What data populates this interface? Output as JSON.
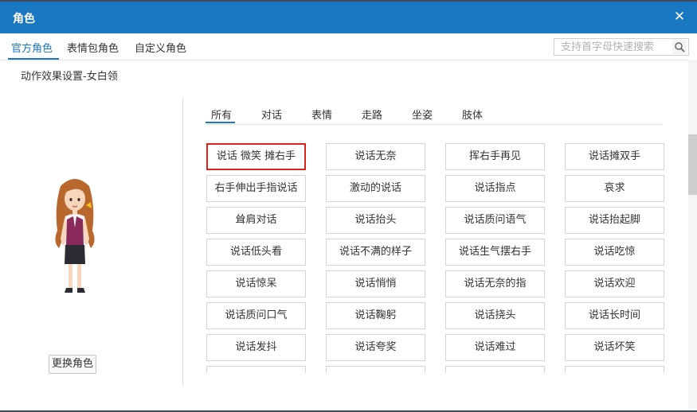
{
  "window": {
    "title": "角色"
  },
  "top_tabs": [
    {
      "label": "官方角色",
      "active": true
    },
    {
      "label": "表情包角色",
      "active": false
    },
    {
      "label": "自定义角色",
      "active": false
    }
  ],
  "search": {
    "placeholder": "支持首字母快速搜索",
    "value": ""
  },
  "subtitle": "动作效果设置-女白领",
  "change_role_label": "更换角色",
  "categories": [
    {
      "label": "所有",
      "active": true
    },
    {
      "label": "对话",
      "active": false
    },
    {
      "label": "表情",
      "active": false
    },
    {
      "label": "走路",
      "active": false
    },
    {
      "label": "坐姿",
      "active": false
    },
    {
      "label": "肢体",
      "active": false
    }
  ],
  "actions": [
    [
      "说话 微笑 摊右手",
      "说话无奈",
      "挥右手再见",
      "说话摊双手"
    ],
    [
      "右手伸出手指说话",
      "激动的说话",
      "说话指点",
      "哀求"
    ],
    [
      "耸肩对话",
      "说话抬头",
      "说话质问语气",
      "说话抬起脚"
    ],
    [
      "说话低头看",
      "说话不满的样子",
      "说话生气摆右手",
      "说话吃惊"
    ],
    [
      "说话惊呆",
      "说话悄悄",
      "说话无奈的指",
      "说话欢迎"
    ],
    [
      "说话质问口气",
      "说话鞠躬",
      "说话挠头",
      "说话长时间"
    ],
    [
      "说话发抖",
      "说话夸奖",
      "说话难过",
      "说话坏笑"
    ],
    [
      "",
      "",
      "",
      ""
    ]
  ],
  "selected_action": "说话 微笑 摊右手",
  "colors": {
    "accent": "#1a78c2",
    "selected_border": "#d9221c"
  }
}
